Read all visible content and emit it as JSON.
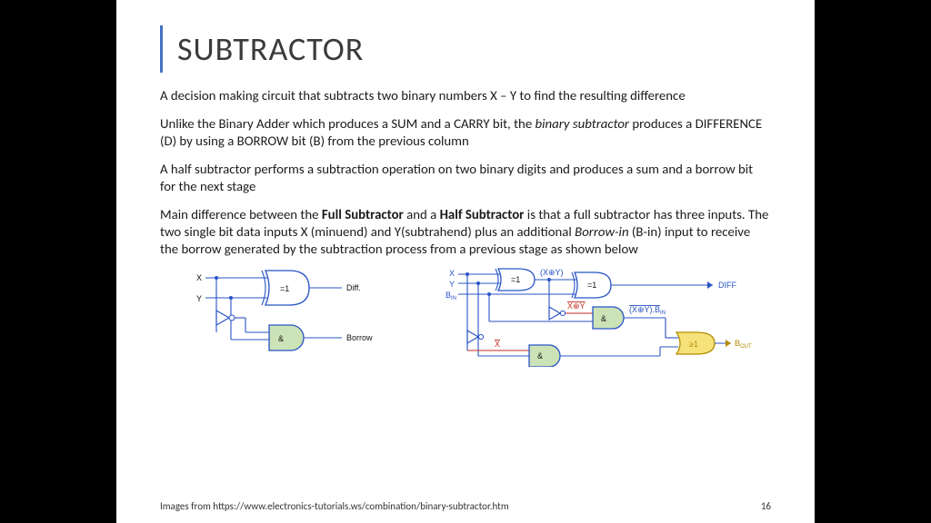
{
  "slide": {
    "title": "SUBTRACTOR",
    "paragraphs": {
      "p1": "A decision making circuit that subtracts two binary numbers X – Y to find the resulting difference",
      "p2_a": "Unlike the Binary Adder which produces a SUM and a CARRY bit, the ",
      "p2_b_i": "binary subtractor",
      "p2_c": " produces a DIFFERENCE (D) by using a BORROW bit (B) from the previous column",
      "p3": "A half subtractor performs a subtraction operation on two binary digits and produces a sum and a borrow bit for the next stage",
      "p4_a": "Main difference between the ",
      "p4_b_b": "Full Subtractor",
      "p4_c": " and a ",
      "p4_d_b": "Half Subtractor",
      "p4_e": " is that a full subtractor has three inputs. The two single bit data inputs X (minuend) and Y(subtrahend) plus an additional ",
      "p4_f_i": "Borrow-in",
      "p4_g": " (B-in) input to receive the borrow generated by the subtraction process from a previous stage as shown below"
    },
    "footer_left": "Images from https://www.electronics-tutorials.ws/combination/binary-subtractor.htm",
    "footer_page": "16"
  },
  "half_sub": {
    "X": "X",
    "Y": "Y",
    "xor": "=1",
    "and": "&",
    "Diff": "Diff.",
    "Borrow": "Borrow"
  },
  "full_sub": {
    "X": "X",
    "Y": "Y",
    "Bin": "B",
    "xor": "=1",
    "and": "&",
    "or": "≥1",
    "xy": "(X⊕Y)",
    "XbarY": "X⊕Y",
    "Xbar": "X",
    "prod": "(X⊕Y).B",
    "DIFF": "DIFF",
    "Bout": "B",
    "BinSub": "IN",
    "BoutSub": "OUT"
  }
}
